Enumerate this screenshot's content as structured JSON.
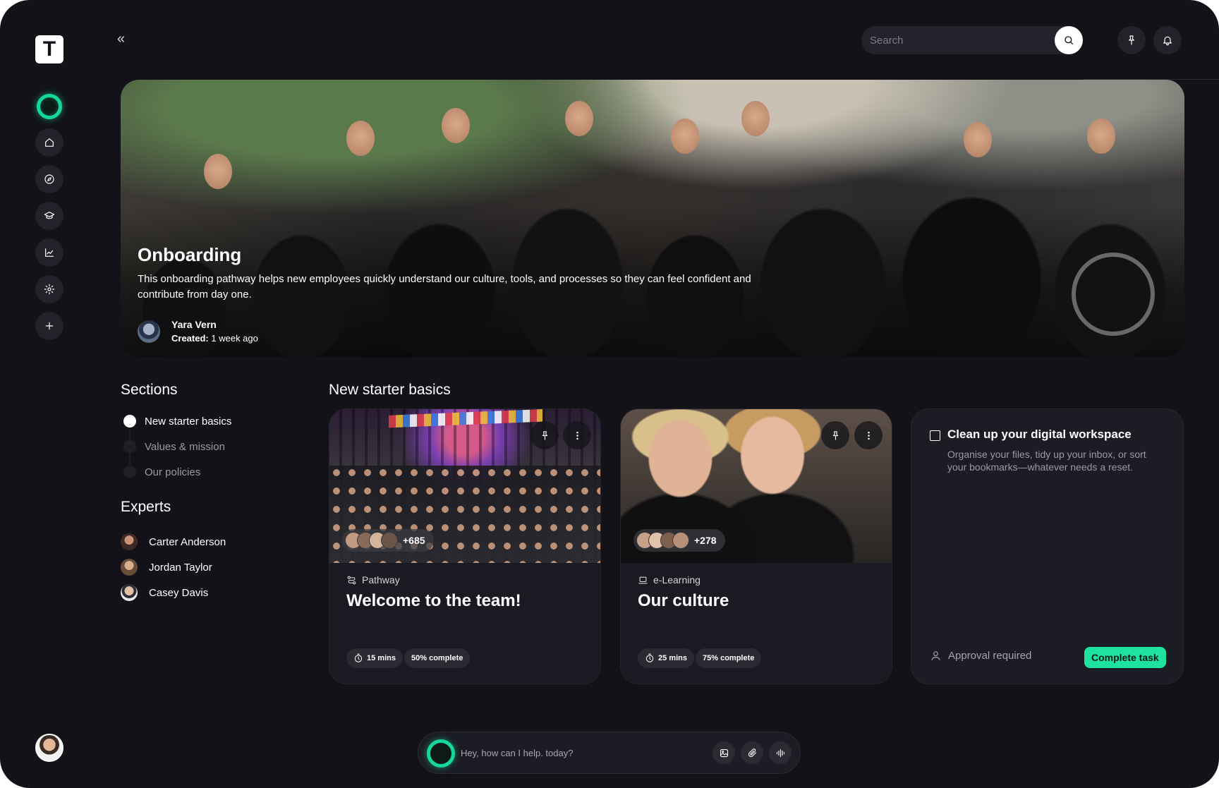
{
  "app": {
    "logo_letter": "T",
    "accent_color": "#1ee3a0"
  },
  "rail": {
    "items": [
      {
        "name": "home-icon"
      },
      {
        "name": "compass-icon"
      },
      {
        "name": "graduation-cap-icon"
      },
      {
        "name": "chart-icon"
      },
      {
        "name": "gear-icon"
      },
      {
        "name": "plus-icon"
      }
    ]
  },
  "header": {
    "collapse_label": "«",
    "search": {
      "placeholder": "Search"
    }
  },
  "hero": {
    "title": "Onboarding",
    "description": "This onboarding pathway helps new employees quickly understand our culture, tools, and processes so they can feel confident and contribute from day one.",
    "author": "Yara Vern",
    "created_label": "Created:",
    "created_value": "1 week ago"
  },
  "sections": {
    "heading": "Sections",
    "items": [
      {
        "label": "New starter basics",
        "active": true
      },
      {
        "label": "Values & mission",
        "active": false
      },
      {
        "label": "Our policies",
        "active": false
      }
    ]
  },
  "experts": {
    "heading": "Experts",
    "items": [
      {
        "name": "Carter Anderson"
      },
      {
        "name": "Jordan Taylor"
      },
      {
        "name": "Casey Davis"
      }
    ]
  },
  "main": {
    "heading": "New starter basics",
    "cards": [
      {
        "type": "Pathway",
        "title": "Welcome to the team!",
        "participants": "+685",
        "duration": "15 mins",
        "progress_label": "50% complete",
        "progress": 0.5
      },
      {
        "type": "e-Learning",
        "title": "Our culture",
        "participants": "+278",
        "duration": "25 mins",
        "progress_label": "75% complete",
        "progress": 0.75
      }
    ],
    "task": {
      "title": "Clean up your digital workspace",
      "description": "Organise your files, tidy up your inbox, or sort your bookmarks—whatever needs a reset.",
      "approval": "Approval required",
      "button": "Complete task"
    }
  },
  "prompt": {
    "placeholder": "Hey, how can I help. today?"
  }
}
